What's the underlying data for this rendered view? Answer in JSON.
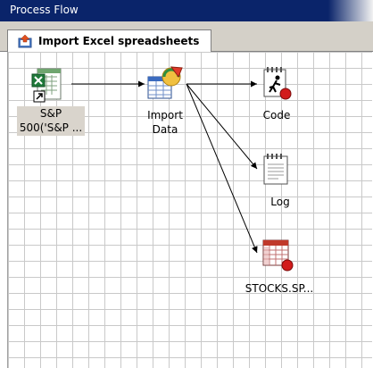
{
  "window": {
    "title": "Process Flow"
  },
  "tab": {
    "label": "Import Excel spreadsheets",
    "icon": "import-wizard-icon"
  },
  "nodes": {
    "source": {
      "line1": "S&P",
      "line2": "500('S&P ...",
      "icon": "excel-shortcut-icon"
    },
    "import": {
      "line1": "Import",
      "line2": "Data",
      "icon": "import-data-icon"
    },
    "code": {
      "label": "Code",
      "icon": "code-icon"
    },
    "log": {
      "label": "Log",
      "icon": "log-icon"
    },
    "stocks": {
      "label": "STOCKS.SP...",
      "icon": "dataset-table-icon"
    }
  },
  "colors": {
    "titlebar": "#0a246a",
    "grid": "#c9c9c9",
    "selection": "#d9d4cc"
  }
}
